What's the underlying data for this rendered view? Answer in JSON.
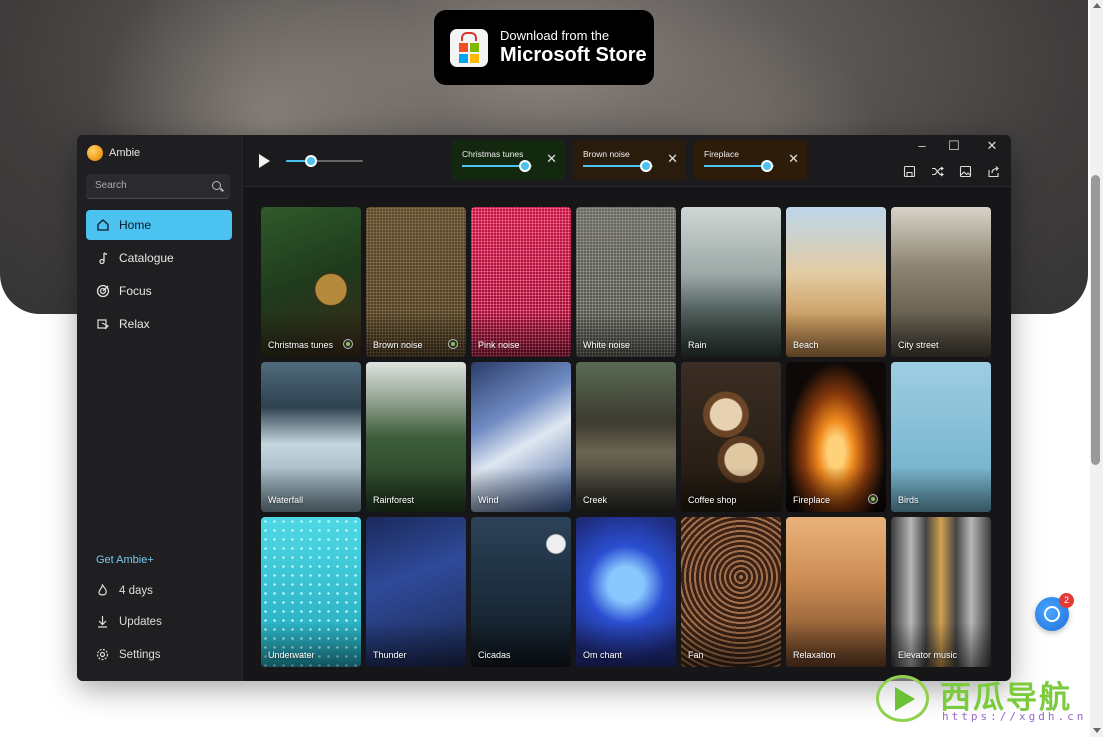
{
  "store_badge": {
    "line1": "Download from the",
    "line2": "Microsoft Store"
  },
  "app": {
    "name": "Ambie",
    "search": {
      "placeholder": "Search",
      "value": ""
    },
    "nav": [
      {
        "label": "Home",
        "icon": "home-icon",
        "active": true
      },
      {
        "label": "Catalogue",
        "icon": "music-note-icon",
        "active": false
      },
      {
        "label": "Focus",
        "icon": "target-icon",
        "active": false
      },
      {
        "label": "Relax",
        "icon": "relax-icon",
        "active": false
      }
    ],
    "get_plus": "Get Ambie+",
    "footer": [
      {
        "label": "4 days",
        "icon": "flame-icon"
      },
      {
        "label": "Updates",
        "icon": "download-icon"
      },
      {
        "label": "Settings",
        "icon": "gear-icon"
      }
    ],
    "player": {
      "volume": 0.33
    },
    "active_sounds": [
      {
        "name": "Christmas tunes",
        "volume": 0.9,
        "color": "#13290f"
      },
      {
        "name": "Brown noise",
        "volume": 0.9,
        "color": "#2a1c0d"
      },
      {
        "name": "Fireplace",
        "volume": 0.9,
        "color": "#2e1c0a"
      }
    ],
    "toolbar_icons": [
      "save-icon",
      "shuffle-icon",
      "image-icon",
      "share-icon"
    ],
    "sounds": [
      {
        "name": "Christmas tunes",
        "active": true
      },
      {
        "name": "Brown noise",
        "active": true
      },
      {
        "name": "Pink noise",
        "active": false
      },
      {
        "name": "White noise",
        "active": false
      },
      {
        "name": "Rain",
        "active": false
      },
      {
        "name": "Beach",
        "active": false
      },
      {
        "name": "City street",
        "active": false
      },
      {
        "name": "Waterfall",
        "active": false
      },
      {
        "name": "Rainforest",
        "active": false
      },
      {
        "name": "Wind",
        "active": false
      },
      {
        "name": "Creek",
        "active": false
      },
      {
        "name": "Coffee shop",
        "active": false
      },
      {
        "name": "Fireplace",
        "active": true
      },
      {
        "name": "Birds",
        "active": false
      },
      {
        "name": "Underwater",
        "active": false
      },
      {
        "name": "Thunder",
        "active": false
      },
      {
        "name": "Cicadas",
        "active": false
      },
      {
        "name": "Om chant",
        "active": false
      },
      {
        "name": "Fan",
        "active": false
      },
      {
        "name": "Relaxation",
        "active": false
      },
      {
        "name": "Elevator music",
        "active": false
      }
    ]
  },
  "floating_badge": {
    "count": "2"
  },
  "watermark": {
    "title": "西瓜导航",
    "url": "https://xgdh.cn"
  },
  "colors": {
    "accent": "#4cc2f1",
    "sidebar": "#1f1f22",
    "window": "#161618"
  }
}
